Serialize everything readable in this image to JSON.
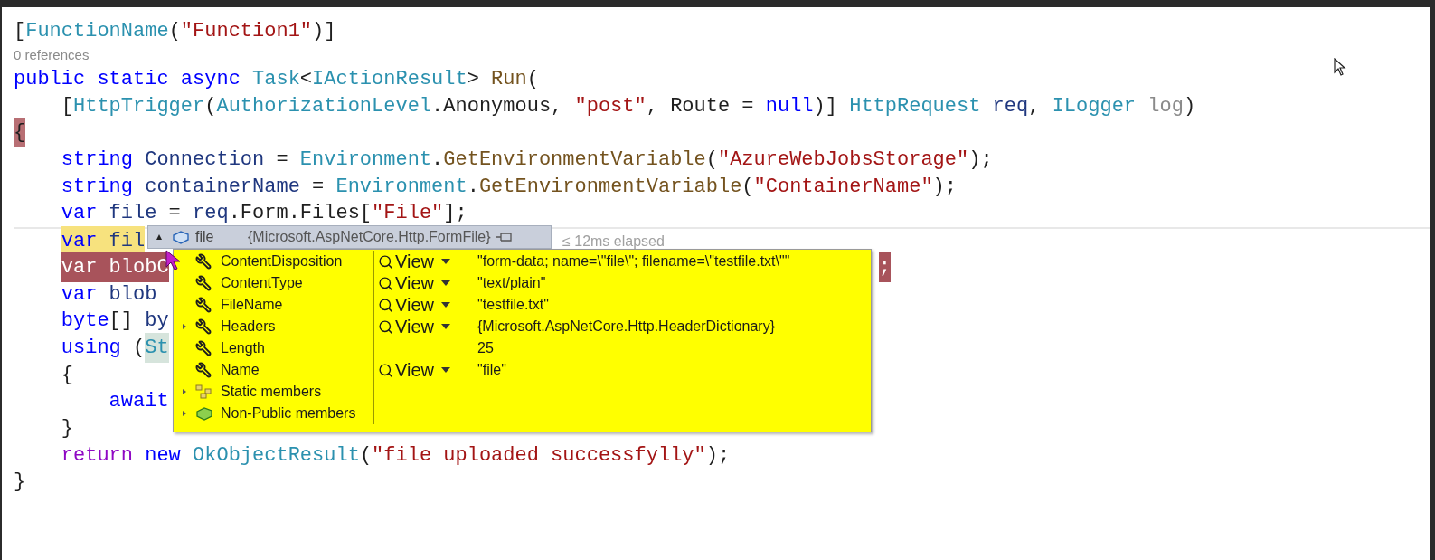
{
  "code_lines": [
    {
      "kind": "code",
      "current": false,
      "breakpoint": false,
      "tokens": [
        {
          "text": "[",
          "kind": "punct"
        },
        {
          "text": "FunctionName",
          "kind": "type"
        },
        {
          "text": "(",
          "kind": "punct"
        },
        {
          "text": "\"Function1\"",
          "kind": "string"
        },
        {
          "text": ")]",
          "kind": "punct"
        }
      ]
    },
    {
      "kind": "codelens",
      "text": "0 references"
    },
    {
      "kind": "code",
      "current": false,
      "breakpoint": false,
      "tokens": [
        {
          "text": "public static async ",
          "kind": "keyword"
        },
        {
          "text": "Task",
          "kind": "type"
        },
        {
          "text": "<",
          "kind": "punct"
        },
        {
          "text": "IActionResult",
          "kind": "type"
        },
        {
          "text": "> ",
          "kind": "punct"
        },
        {
          "text": "Run",
          "kind": "method"
        },
        {
          "text": "(",
          "kind": "punct"
        }
      ],
      "children": [
        {
          "kind": "code",
          "current": false,
          "breakpoint": false,
          "tokens": [
            {
              "text": "[",
              "kind": "punct"
            },
            {
              "text": "HttpTrigger",
              "kind": "type"
            },
            {
              "text": "(",
              "kind": "punct"
            },
            {
              "text": "AuthorizationLevel",
              "kind": "type"
            },
            {
              "text": ".Anonymous, ",
              "kind": "punct"
            },
            {
              "text": "\"post\"",
              "kind": "string"
            },
            {
              "text": ", Route = ",
              "kind": "punct"
            },
            {
              "text": "null",
              "kind": "keyword"
            },
            {
              "text": ")] ",
              "kind": "punct"
            },
            {
              "text": "HttpRequest",
              "kind": "type"
            },
            {
              "text": " req",
              "kind": "variable"
            },
            {
              "text": ", ",
              "kind": "punct"
            },
            {
              "text": "ILogger",
              "kind": "type"
            },
            {
              "text": " log",
              "kind": "unused"
            },
            {
              "text": ")",
              "kind": "punct"
            }
          ]
        }
      ]
    },
    {
      "kind": "code",
      "current": false,
      "breakpoint": false,
      "tokens": [
        {
          "text": "{",
          "kind": "brace_match"
        }
      ],
      "children": [
        {
          "kind": "code",
          "current": false,
          "breakpoint": false,
          "tokens": [
            {
              "text": "string",
              "kind": "keyword"
            },
            {
              "text": " Connection",
              "kind": "variable"
            },
            {
              "text": " = ",
              "kind": "punct"
            },
            {
              "text": "Environment",
              "kind": "type"
            },
            {
              "text": ".",
              "kind": "punct"
            },
            {
              "text": "GetEnvironmentVariable",
              "kind": "method"
            },
            {
              "text": "(",
              "kind": "punct"
            },
            {
              "text": "\"AzureWebJobsStorage\"",
              "kind": "string"
            },
            {
              "text": ");",
              "kind": "punct"
            }
          ]
        },
        {
          "kind": "code",
          "current": false,
          "breakpoint": false,
          "tokens": [
            {
              "text": "string",
              "kind": "keyword"
            },
            {
              "text": " containerName",
              "kind": "variable"
            },
            {
              "text": " = ",
              "kind": "punct"
            },
            {
              "text": "Environment",
              "kind": "type"
            },
            {
              "text": ".",
              "kind": "punct"
            },
            {
              "text": "GetEnvironmentVariable",
              "kind": "method"
            },
            {
              "text": "(",
              "kind": "punct"
            },
            {
              "text": "\"ContainerName\"",
              "kind": "string"
            },
            {
              "text": ");",
              "kind": "punct"
            }
          ]
        },
        {
          "kind": "code",
          "current": false,
          "breakpoint": false,
          "tokens": [
            {
              "text": "var",
              "kind": "keyword"
            },
            {
              "text": " file",
              "kind": "variable"
            },
            {
              "text": " = ",
              "kind": "punct"
            },
            {
              "text": "req",
              "kind": "variable"
            },
            {
              "text": ".Form.Files[",
              "kind": "punct"
            },
            {
              "text": "\"File\"",
              "kind": "string"
            },
            {
              "text": "];",
              "kind": "punct"
            }
          ]
        },
        {
          "kind": "code",
          "current": true,
          "breakpoint": false,
          "tokens": [
            {
              "text": "var",
              "kind": "keyword"
            },
            {
              "text": " fil",
              "kind": "variable"
            }
          ]
        },
        {
          "kind": "code",
          "current": false,
          "breakpoint": true,
          "tokens": [
            {
              "text": "var blobC",
              "kind": "keyword"
            }
          ],
          "tail": ";"
        },
        {
          "kind": "code",
          "current": false,
          "breakpoint": false,
          "tokens": [
            {
              "text": "var",
              "kind": "keyword"
            },
            {
              "text": " blob",
              "kind": "variable"
            }
          ]
        },
        {
          "kind": "code",
          "current": false,
          "breakpoint": false,
          "tokens": [
            {
              "text": "byte",
              "kind": "keyword"
            },
            {
              "text": "[] ",
              "kind": "punct"
            },
            {
              "text": "by",
              "kind": "variable"
            }
          ]
        },
        {
          "kind": "code",
          "current": false,
          "breakpoint": false,
          "tokens": [
            {
              "text": "using",
              "kind": "keyword"
            },
            {
              "text": " (",
              "kind": "punct"
            },
            {
              "text": "St",
              "kind": "reference"
            }
          ]
        },
        {
          "kind": "code",
          "current": false,
          "breakpoint": false,
          "tokens": [
            {
              "text": "{",
              "kind": "punct"
            }
          ],
          "children": [
            {
              "kind": "code",
              "current": false,
              "breakpoint": false,
              "tokens": [
                {
                  "text": "await",
                  "kind": "keyword"
                }
              ]
            }
          ]
        },
        {
          "kind": "code",
          "current": false,
          "breakpoint": false,
          "tokens": [
            {
              "text": "}",
              "kind": "punct"
            }
          ]
        },
        {
          "kind": "code",
          "current": false,
          "breakpoint": false,
          "tokens": [
            {
              "text": "return",
              "kind": "control"
            },
            {
              "text": " new ",
              "kind": "keyword"
            },
            {
              "text": "OkObjectResult",
              "kind": "type"
            },
            {
              "text": "(",
              "kind": "punct"
            },
            {
              "text": "\"file uploaded successfylly\"",
              "kind": "string"
            },
            {
              "text": ");",
              "kind": "punct"
            }
          ]
        }
      ]
    },
    {
      "kind": "code",
      "current": false,
      "breakpoint": false,
      "tokens": [
        {
          "text": "}",
          "kind": "punct"
        }
      ]
    }
  ],
  "perf_tip": "≤ 12ms elapsed",
  "datatip": {
    "name": "file",
    "type": "{Microsoft.AspNetCore.Http.FormFile}",
    "rows": [
      {
        "kind": "property",
        "expandable": false,
        "name": "ContentDisposition",
        "view": "View",
        "value": "\"form-data; name=\\\"file\\\"; filename=\\\"testfile.txt\\\"\""
      },
      {
        "kind": "property",
        "expandable": false,
        "name": "ContentType",
        "view": "View",
        "value": "\"text/plain\""
      },
      {
        "kind": "property",
        "expandable": false,
        "name": "FileName",
        "view": "View",
        "value": "\"testfile.txt\""
      },
      {
        "kind": "property",
        "expandable": true,
        "name": "Headers",
        "view": "View",
        "value": "{Microsoft.AspNetCore.Http.HeaderDictionary}"
      },
      {
        "kind": "property",
        "expandable": false,
        "name": "Length",
        "value": "25"
      },
      {
        "kind": "property",
        "expandable": false,
        "name": "Name",
        "view": "View",
        "value": "\"file\""
      },
      {
        "kind": "static",
        "expandable": true,
        "name": "Static members"
      },
      {
        "kind": "nonpublic",
        "expandable": true,
        "name": "Non-Public members"
      }
    ]
  }
}
